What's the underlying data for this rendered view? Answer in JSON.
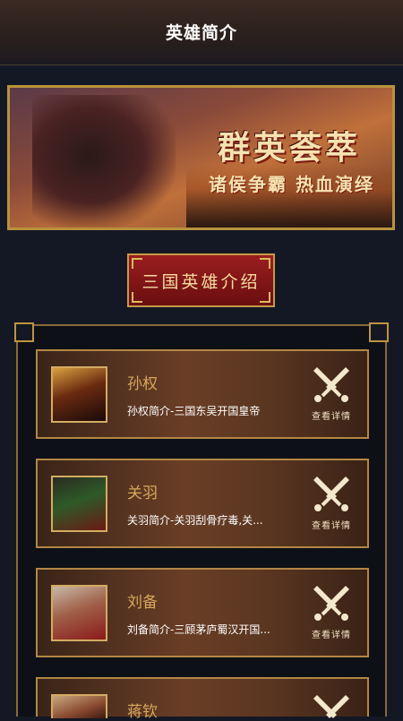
{
  "header": {
    "title": "英雄简介"
  },
  "banner": {
    "slogan_main": "群英荟萃",
    "slogan_sub": "诸侯争霸 热血演绎"
  },
  "section": {
    "title": "三国英雄介绍"
  },
  "heroes": [
    {
      "name": "孙权",
      "desc": "孙权简介-三国东吴开国皇帝",
      "detail_label": "查看详情"
    },
    {
      "name": "关羽",
      "desc": "关羽简介-关羽刮骨疗毒,关...",
      "detail_label": "查看详情"
    },
    {
      "name": "刘备",
      "desc": "刘备简介-三顾茅庐蜀汉开国...",
      "detail_label": "查看详情"
    },
    {
      "name": "蒋钦",
      "desc": "",
      "detail_label": ""
    }
  ],
  "colors": {
    "accent_gold": "#b8923c",
    "name_gold": "#d7a85b",
    "red": "#8a1518"
  }
}
